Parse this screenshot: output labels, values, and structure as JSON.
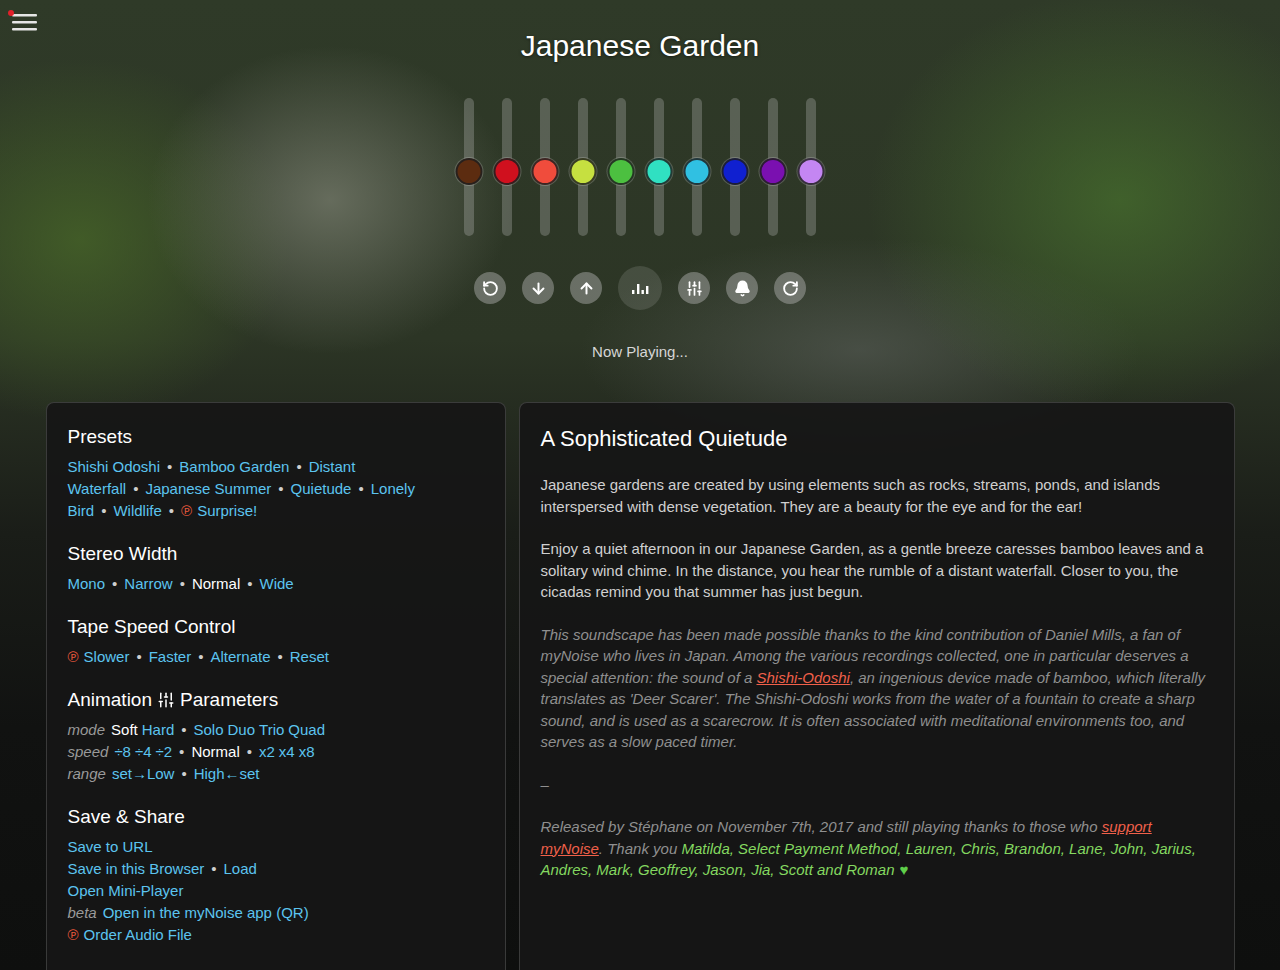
{
  "menu_button": {
    "notification": true
  },
  "title": "Japanese Garden",
  "sliders": [
    {
      "level": 0.46,
      "color": "#5c2c10"
    },
    {
      "level": 0.46,
      "color": "#d0101e"
    },
    {
      "level": 0.46,
      "color": "#f04c3c"
    },
    {
      "level": 0.46,
      "color": "#c6e040"
    },
    {
      "level": 0.46,
      "color": "#4cc040"
    },
    {
      "level": 0.46,
      "color": "#30e0c2"
    },
    {
      "level": 0.46,
      "color": "#30c0e2"
    },
    {
      "level": 0.46,
      "color": "#1020d0"
    },
    {
      "level": 0.46,
      "color": "#7a10b0"
    },
    {
      "level": 0.46,
      "color": "#c486f2"
    }
  ],
  "controls": [
    {
      "kind": "reset",
      "selected": false
    },
    {
      "kind": "down",
      "selected": false
    },
    {
      "kind": "up",
      "selected": false
    },
    {
      "kind": "bars",
      "selected": true
    },
    {
      "kind": "sliders",
      "selected": false
    },
    {
      "kind": "bell",
      "selected": false
    },
    {
      "kind": "timer",
      "selected": false
    }
  ],
  "status": "Now Playing...",
  "left_panel": {
    "separator": "•",
    "sections": [
      {
        "title": "Presets",
        "rows": [
          {
            "groups": [
              [
                {
                  "text": "Shishi Odoshi",
                  "selected": false
                }
              ],
              [
                {
                  "text": "Bamboo Garden",
                  "selected": false
                }
              ],
              [
                {
                  "text": "Distant Waterfall",
                  "selected": false
                }
              ],
              [
                {
                  "text": "Japanese Summer",
                  "selected": false
                }
              ],
              [
                {
                  "text": "Quietude",
                  "selected": false
                }
              ],
              [
                {
                  "text": "Lonely Bird",
                  "selected": false
                }
              ],
              [
                {
                  "text": "Wildlife",
                  "selected": false
                }
              ],
              [
                {
                  "text": "Surprise!",
                  "selected": false,
                  "badge": "℗"
                }
              ]
            ]
          }
        ]
      },
      {
        "title": "Stereo Width",
        "rows": [
          {
            "groups": [
              [
                {
                  "text": "Mono",
                  "selected": false
                }
              ],
              [
                {
                  "text": "Narrow",
                  "selected": false
                }
              ],
              [
                {
                  "text": "Normal",
                  "selected": true
                }
              ],
              [
                {
                  "text": "Wide",
                  "selected": false
                }
              ]
            ]
          }
        ]
      },
      {
        "title": "Tape Speed Control",
        "rows": [
          {
            "groups": [
              [
                {
                  "text": "Slower",
                  "selected": false,
                  "badge": "℗"
                }
              ],
              [
                {
                  "text": "Faster",
                  "selected": false
                }
              ],
              [
                {
                  "text": "Alternate",
                  "selected": false
                }
              ],
              [
                {
                  "text": "Reset",
                  "selected": false
                }
              ]
            ]
          }
        ]
      },
      {
        "title": "Animation",
        "title_suffix": "Parameters",
        "rows": [
          {
            "label": "mode",
            "groups": [
              [
                {
                  "text": "Soft",
                  "selected": true
                },
                {
                  "text": "Hard",
                  "selected": false
                }
              ],
              [
                {
                  "text": "Solo",
                  "selected": false
                },
                {
                  "text": "Duo",
                  "selected": false
                },
                {
                  "text": "Trio",
                  "selected": false
                },
                {
                  "text": "Quad",
                  "selected": false
                }
              ]
            ]
          },
          {
            "label": "speed",
            "groups": [
              [
                {
                  "text": "÷8",
                  "selected": false
                },
                {
                  "text": "÷4",
                  "selected": false
                },
                {
                  "text": "÷2",
                  "selected": false
                }
              ],
              [
                {
                  "text": "Normal",
                  "selected": true
                }
              ],
              [
                {
                  "text": "x2",
                  "selected": false
                },
                {
                  "text": "x4",
                  "selected": false
                },
                {
                  "text": "x8",
                  "selected": false
                }
              ]
            ]
          },
          {
            "label": "range",
            "groups": [
              [
                {
                  "text": "set→Low",
                  "selected": false
                }
              ],
              [
                {
                  "text": "High←set",
                  "selected": false
                }
              ]
            ]
          }
        ]
      },
      {
        "title": "Save & Share",
        "rows": [
          {
            "groups": [
              [
                {
                  "text": "Save to URL",
                  "selected": false
                }
              ]
            ]
          },
          {
            "groups": [
              [
                {
                  "text": "Save in this Browser",
                  "selected": false
                }
              ],
              [
                {
                  "text": "Load",
                  "selected": false
                }
              ]
            ]
          },
          {
            "groups": [
              [
                {
                  "text": "Open Mini-Player",
                  "selected": false
                }
              ]
            ]
          },
          {
            "label": "beta",
            "groups": [
              [
                {
                  "text": "Open in the myNoise app (QR)",
                  "selected": false
                }
              ]
            ]
          },
          {
            "groups": [
              [
                {
                  "text": "Order Audio File",
                  "selected": false,
                  "badge": "℗"
                }
              ]
            ]
          }
        ]
      }
    ]
  },
  "right_panel": {
    "title": "A Sophisticated Quietude",
    "paragraphs": [
      {
        "kind": "body",
        "spans": [
          {
            "kind": "text",
            "text": "Japanese gardens are created by using elements such as rocks, streams, ponds, and islands interspersed with dense vegetation. They are a beauty for the eye and for the ear!"
          }
        ]
      },
      {
        "kind": "body",
        "spans": [
          {
            "kind": "text",
            "text": "Enjoy a quiet afternoon in our Japanese Garden, as a gentle breeze caresses bamboo leaves and a solitary wind chime. In the distance, you hear the rumble of a distant waterfall. Closer to you, the cicadas remind you that summer has just begun."
          }
        ]
      },
      {
        "kind": "credit",
        "spans": [
          {
            "kind": "text",
            "text": "This soundscape has been made possible thanks to the kind contribution of Daniel Mills, a fan of myNoise who lives in Japan. Among the various recordings collected, one in particular deserves a special attention: the sound of a "
          },
          {
            "kind": "link",
            "text": "Shishi-Odoshi"
          },
          {
            "kind": "text",
            "text": ", an ingenious device made of bamboo, which literally translates as 'Deer Scarer'. The Shishi-Odoshi works from the water of a fountain to create a sharp sound, and is used as a scarecrow. It is often associated with meditational environments too, and serves as a slow paced timer."
          }
        ]
      },
      {
        "kind": "credit",
        "spans": [
          {
            "kind": "text",
            "text": "–"
          }
        ]
      },
      {
        "kind": "credit",
        "spans": [
          {
            "kind": "text",
            "text": "Released by Stéphane on November 7th, 2017 and still playing thanks to those who "
          },
          {
            "kind": "link",
            "text": "support myNoise"
          },
          {
            "kind": "text",
            "text": ". Thank you "
          },
          {
            "kind": "name",
            "text": "Matilda, Select Payment Method, Lauren, Chris, Brandon, Lane, John, Jarius, Andres, Mark, Geoffrey, Jason, Jia, Scott and Roman"
          },
          {
            "kind": "heart",
            "text": "♥"
          }
        ]
      }
    ]
  }
}
